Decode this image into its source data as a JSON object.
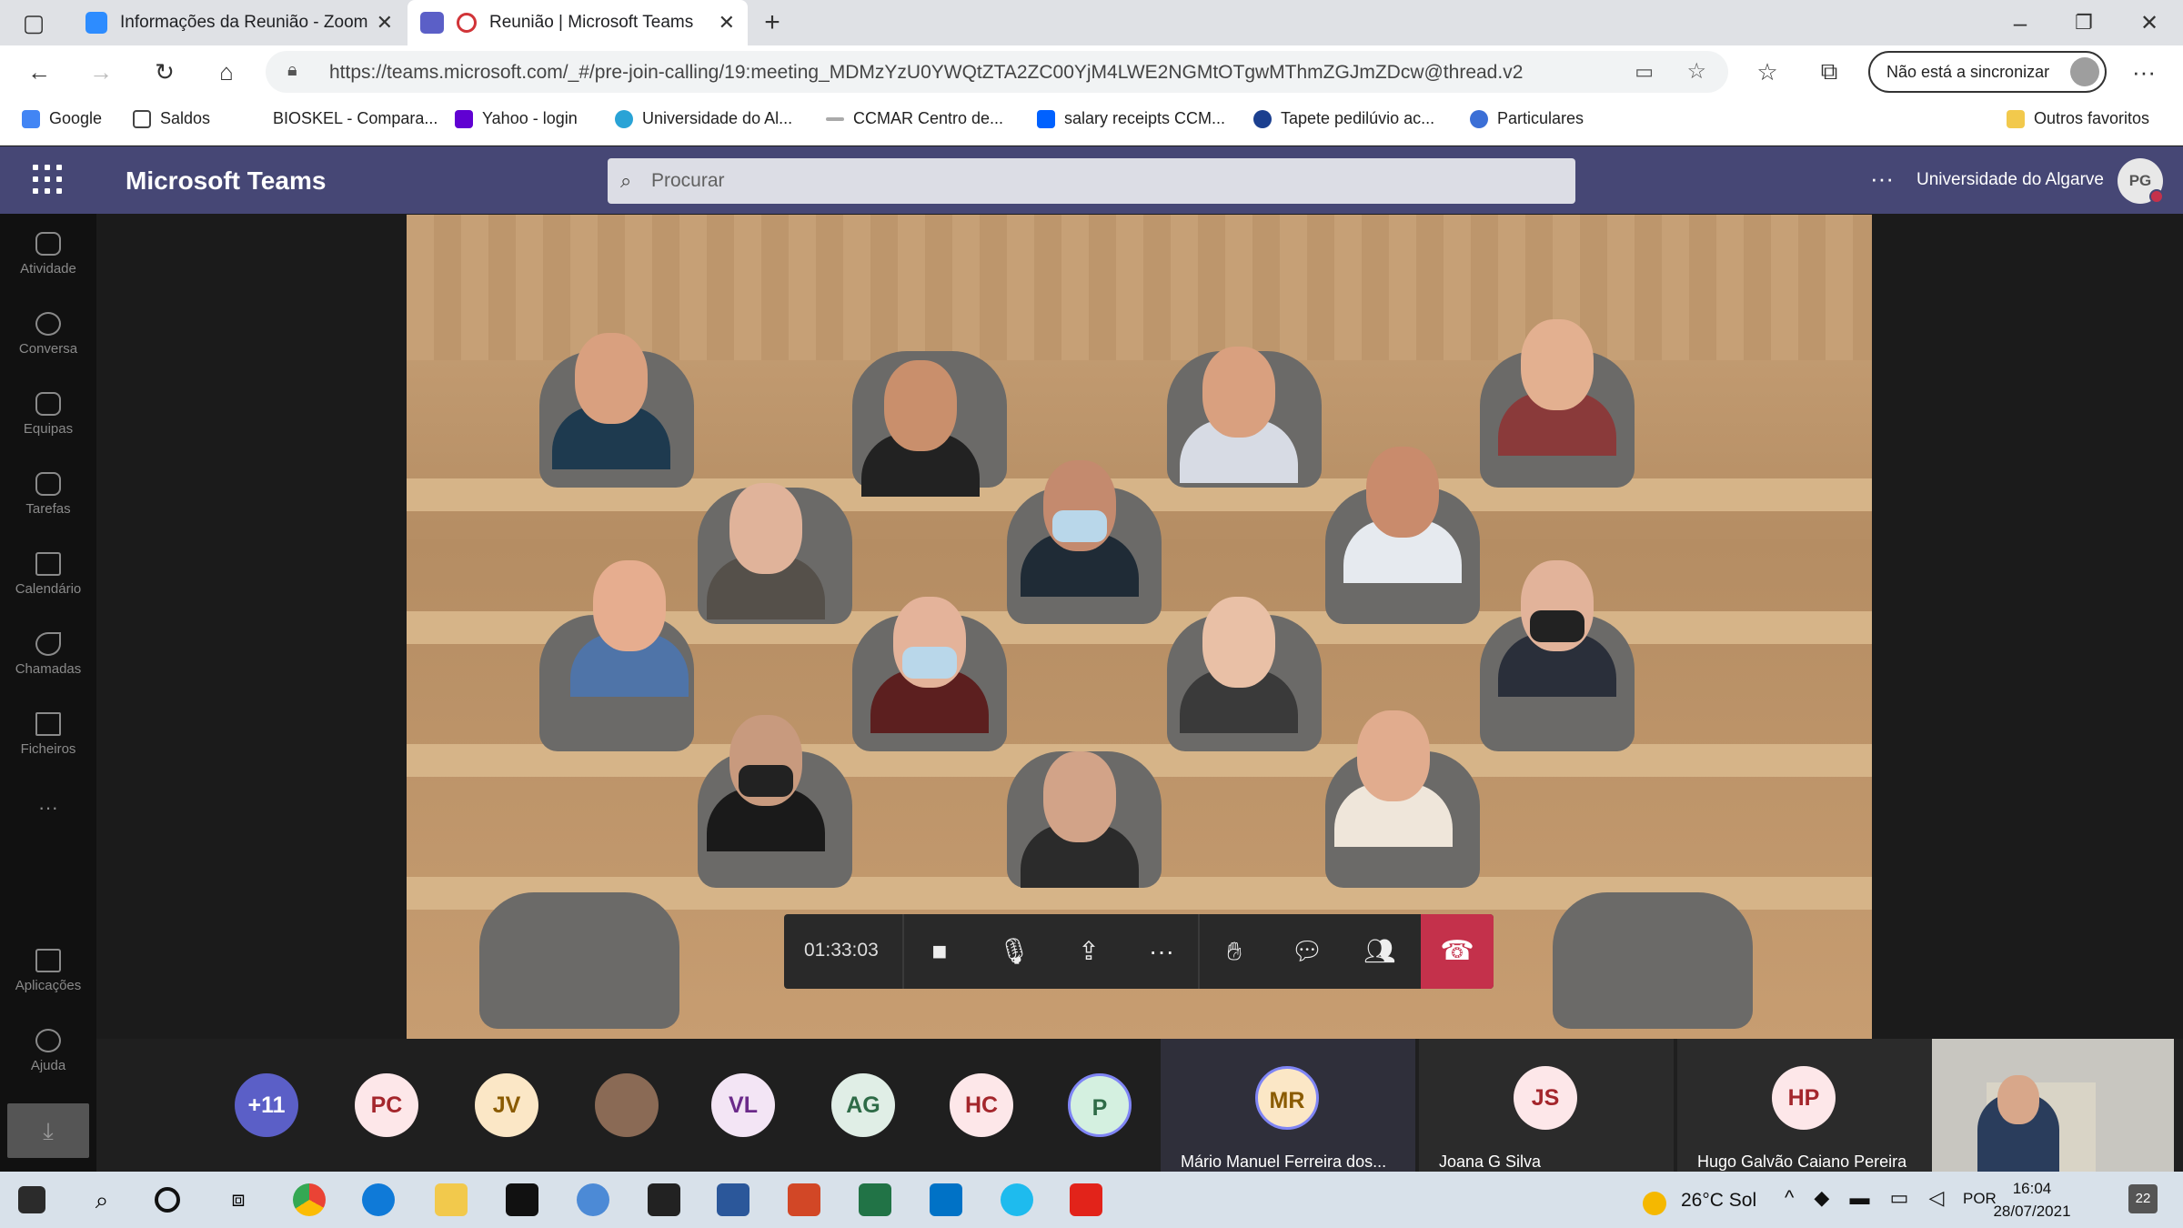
{
  "browser": {
    "tabs": [
      {
        "title": "Informações da Reunião - Zoom",
        "active": false
      },
      {
        "title": "Reunião | Microsoft Teams",
        "active": true
      }
    ],
    "url": "https://teams.microsoft.com/_#/pre-join-calling/19:meeting_MDMzYzU0YWQtZTA2ZC00YjM4LWE2NGMtOTgwMThmZGJmZDcw@thread.v2",
    "sync_label": "Não está a sincronizar",
    "bookmarks": [
      "Google",
      "Saldos",
      "BIOSKEL - Compara...",
      "Yahoo - login",
      "Universidade do Al...",
      "CCMAR  Centro de...",
      "salary receipts CCM...",
      "Tapete pedilúvio ac...",
      "Particulares"
    ],
    "other_favorites": "Outros favoritos"
  },
  "teams": {
    "app_name": "Microsoft Teams",
    "search_placeholder": "Procurar",
    "more": "···",
    "org": "Universidade do Algarve",
    "user_initials": "PG",
    "rail": [
      "Atividade",
      "Conversa",
      "Equipas",
      "Tarefas",
      "Calendário",
      "Chamadas",
      "Ficheiros",
      "Aplicações",
      "Ajuda"
    ],
    "rail_more": "···"
  },
  "call": {
    "timer": "01:33:03",
    "participants_strip": [
      "+11",
      "PC",
      "JV",
      "VL",
      "AG",
      "HC",
      "P",
      "MR",
      "JS",
      "HP"
    ],
    "tiles": [
      {
        "initials": "MR",
        "name": "Mário Manuel Ferreira dos..."
      },
      {
        "initials": "JS",
        "name": "Joana G Silva"
      },
      {
        "initials": "HP",
        "name": "Hugo Galvão Caiano Pereira"
      }
    ]
  },
  "taskbar": {
    "weather": "26°C  Sol",
    "lang": "POR",
    "time": "16:04",
    "date": "28/07/2021",
    "notifications": "22"
  },
  "colors": {
    "teams_header": "#464775",
    "hangup": "#c4314b"
  }
}
